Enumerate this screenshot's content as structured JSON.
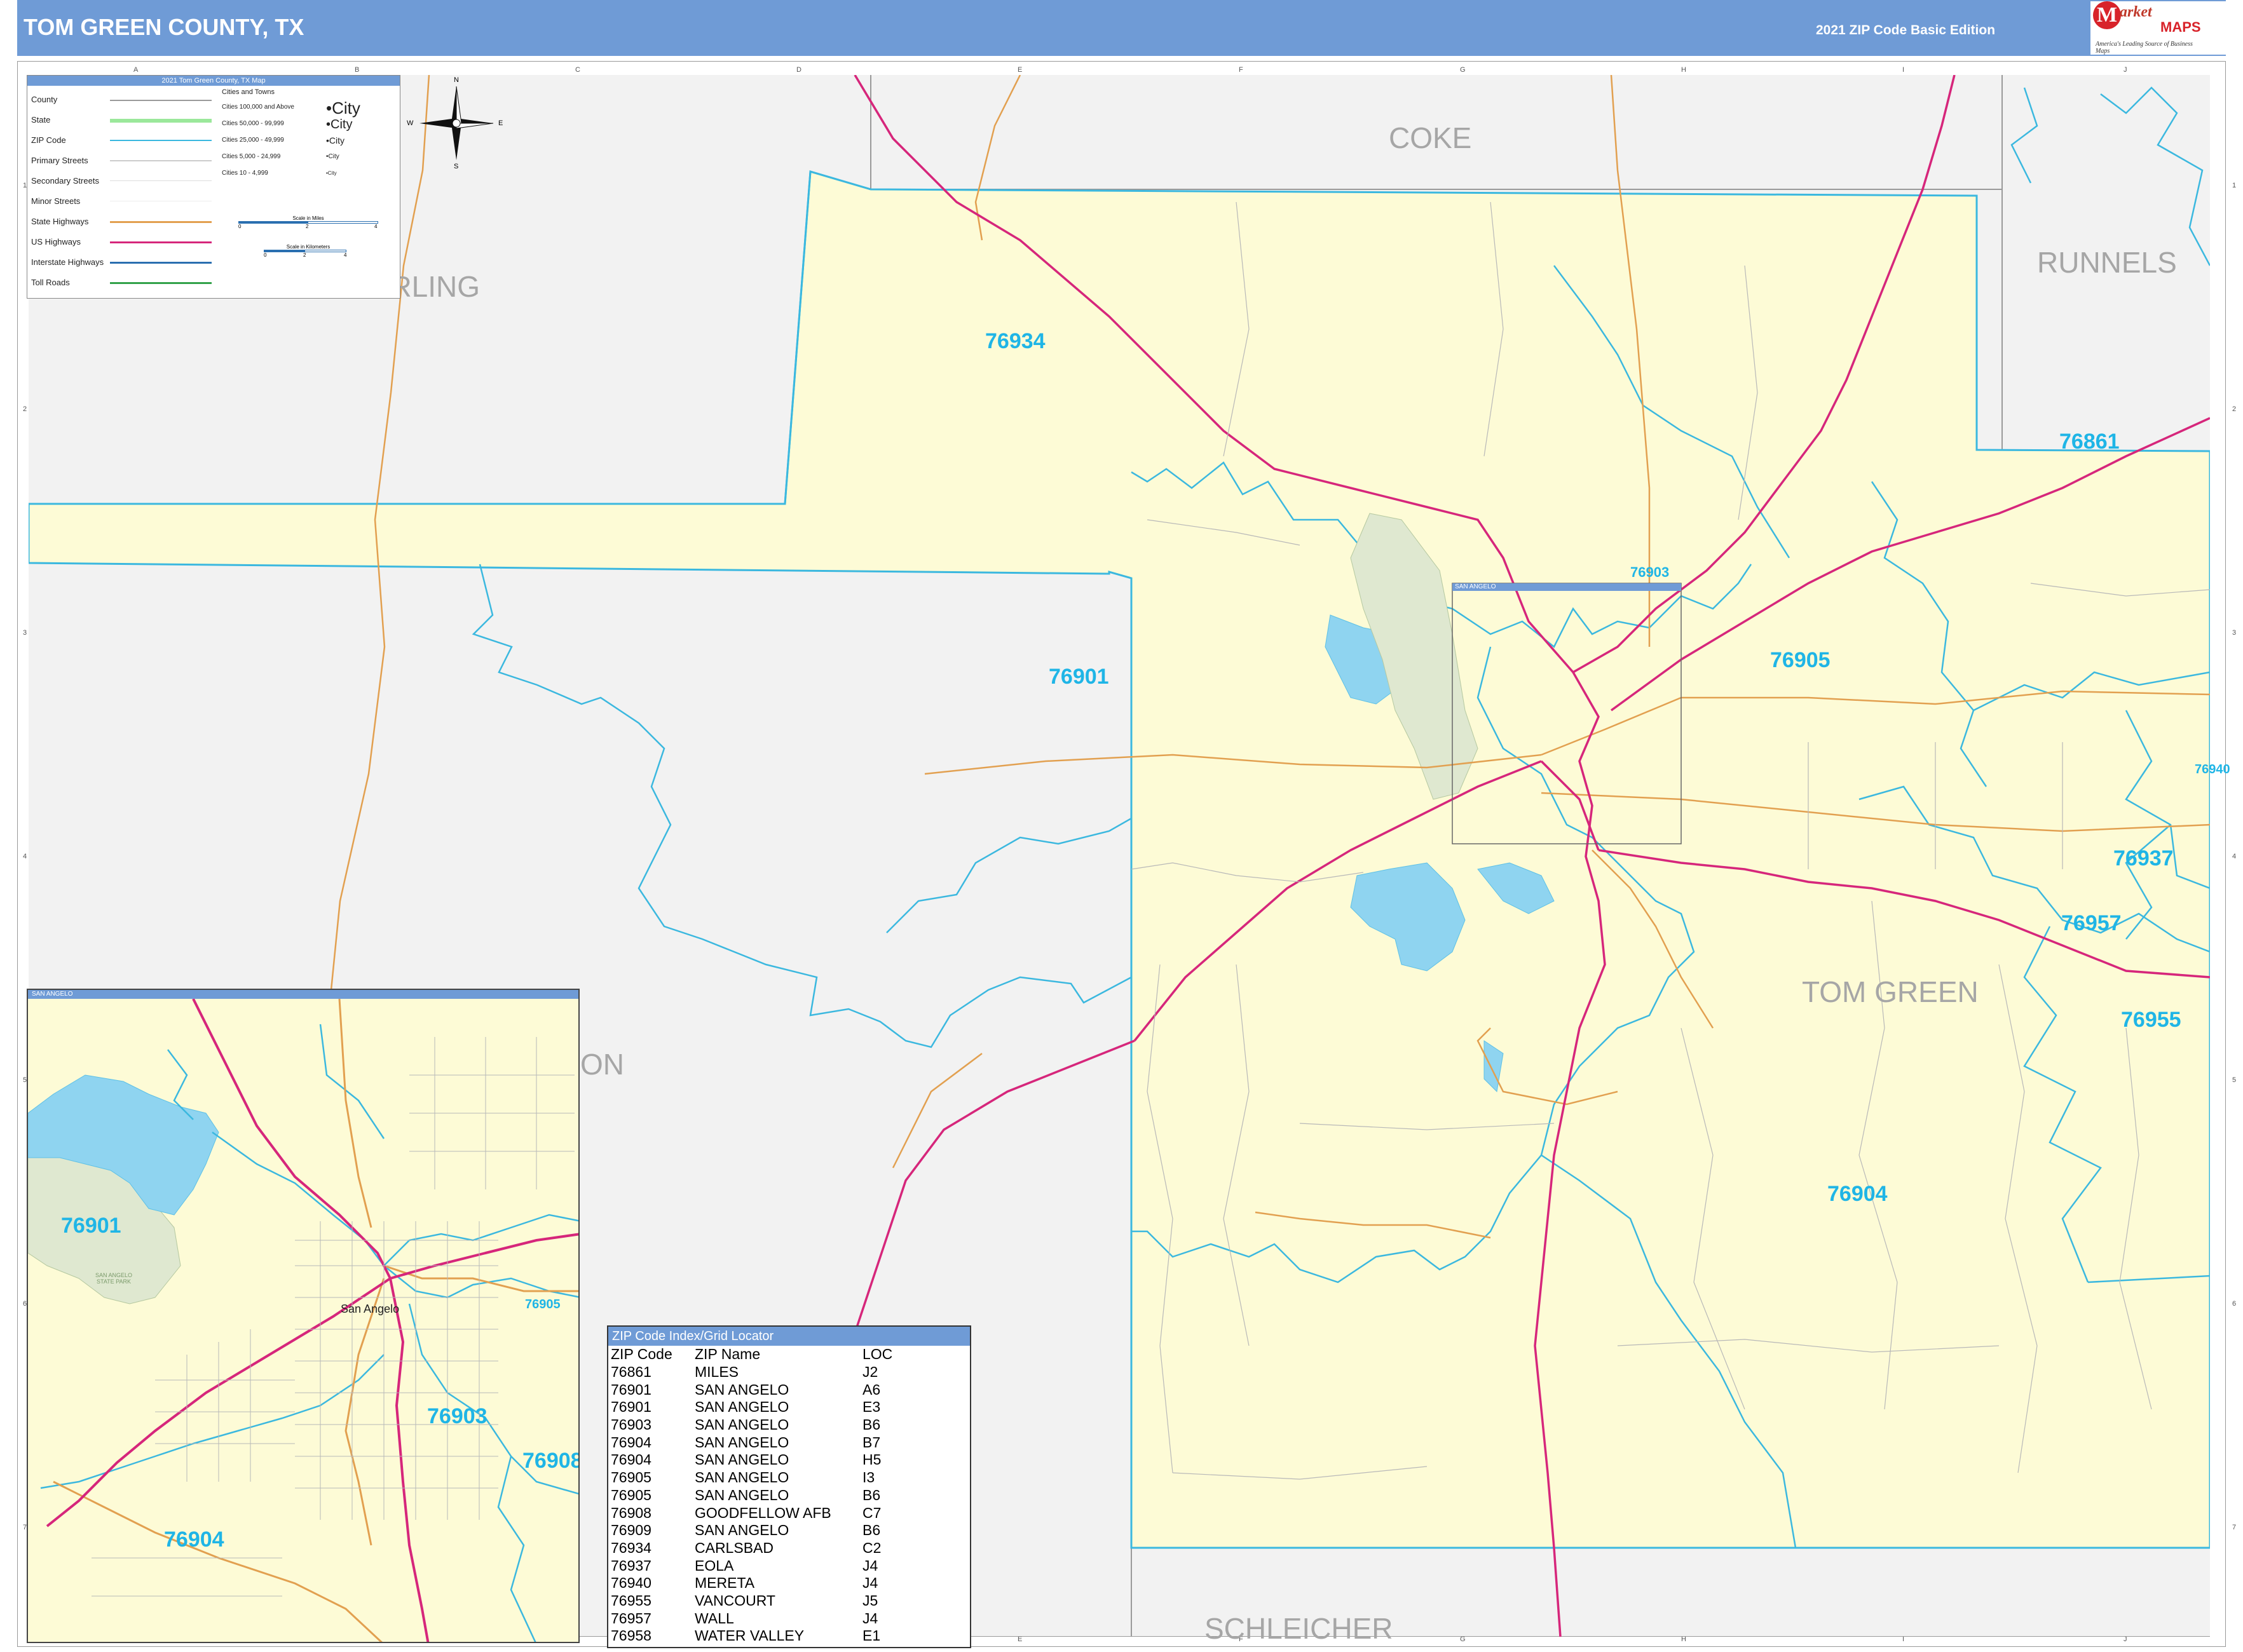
{
  "header": {
    "title": "TOM GREEN COUNTY, TX",
    "edition": "2021 ZIP Code Basic Edition"
  },
  "logo": {
    "mark": "M",
    "market": "arket",
    "maps": "MAPS",
    "tagline": "America's Leading Source of Business Maps"
  },
  "grid": {
    "columns": [
      "A",
      "B",
      "C",
      "D",
      "E",
      "F",
      "G",
      "H",
      "I",
      "J"
    ],
    "rows": [
      "1",
      "2",
      "3",
      "4",
      "5",
      "6",
      "7"
    ]
  },
  "map": {
    "counties": {
      "coke": "COKE",
      "runnels": "RUNNELS",
      "sterling": "STERLING",
      "tom_green": "TOM GREEN",
      "schleicher": "SCHLEICHER",
      "irion_fragment": "ON"
    },
    "zips": {
      "z76934": "76934",
      "z76901": "76901",
      "z76903": "76903",
      "z76905": "76905",
      "z76861": "76861",
      "z76940": "76940",
      "z76937": "76937",
      "z76957": "76957",
      "z76955": "76955",
      "z76904": "76904"
    },
    "san_angelo_box_label": "SAN ANGELO",
    "colors": {
      "county_fill": "#fdfbd6",
      "outside_fill": "#f2f2f2",
      "zip_line": "#3bb8df",
      "us_highway": "#d6267b",
      "state_highway": "#e2a050",
      "lake": "#8fd4f0",
      "park": "#dfe8d0"
    }
  },
  "legend": {
    "title": "2021 Tom Green County, TX Map",
    "items": [
      {
        "label": "County",
        "color": "#9a9a9a"
      },
      {
        "label": "State",
        "color": "#9be89b"
      },
      {
        "label": "ZIP Code",
        "color": "#3bb8df"
      },
      {
        "label": "Primary Streets",
        "color": "#cccccc"
      },
      {
        "label": "Secondary Streets",
        "color": "#dddddd"
      },
      {
        "label": "Minor Streets",
        "color": "#eeeeee"
      },
      {
        "label": "State Highways",
        "color": "#e2a050"
      },
      {
        "label": "US Highways",
        "color": "#d6267b"
      },
      {
        "label": "Interstate Highways",
        "color": "#2a6fb0"
      },
      {
        "label": "Toll Roads",
        "color": "#33a24a"
      }
    ],
    "cities_heading": "Cities and Towns",
    "cities": [
      {
        "label": "Cities 100,000 and Above",
        "sample": "•City"
      },
      {
        "label": "Cities 50,000 - 99,999",
        "sample": "•City"
      },
      {
        "label": "Cities 25,000 - 49,999",
        "sample": "•City"
      },
      {
        "label": "Cities 5,000 - 24,999",
        "sample": "•City"
      },
      {
        "label": "Cities 10 - 4,999",
        "sample": "•City"
      }
    ],
    "compass": {
      "n": "N",
      "s": "S",
      "e": "E",
      "w": "W"
    },
    "scale_miles": "Scale in Miles",
    "scale_km": "Scale in Kilometers",
    "scale_miles_ticks": [
      "0",
      "2",
      "4"
    ],
    "scale_km_ticks": [
      "0",
      "2",
      "4"
    ]
  },
  "inset": {
    "title": "SAN ANGELO",
    "city": "San Angelo",
    "zips": {
      "z76901": "76901",
      "z76903": "76903",
      "z76905": "76905",
      "z76908": "76908",
      "z76904": "76904"
    },
    "park_label": "SAN ANGELO STATE PARK"
  },
  "zip_index": {
    "title": "ZIP Code Index/Grid Locator",
    "headers": [
      "ZIP Code",
      "ZIP Name",
      "LOC"
    ],
    "rows": [
      [
        "76861",
        "MILES",
        "J2"
      ],
      [
        "76901",
        "SAN ANGELO",
        "A6"
      ],
      [
        "76901",
        "SAN ANGELO",
        "E3"
      ],
      [
        "76903",
        "SAN ANGELO",
        "B6"
      ],
      [
        "76904",
        "SAN ANGELO",
        "B7"
      ],
      [
        "76904",
        "SAN ANGELO",
        "H5"
      ],
      [
        "76905",
        "SAN ANGELO",
        "I3"
      ],
      [
        "76905",
        "SAN ANGELO",
        "B6"
      ],
      [
        "76908",
        "GOODFELLOW AFB",
        "C7"
      ],
      [
        "76909",
        "SAN ANGELO",
        "B6"
      ],
      [
        "76934",
        "CARLSBAD",
        "C2"
      ],
      [
        "76937",
        "EOLA",
        "J4"
      ],
      [
        "76940",
        "MERETA",
        "J4"
      ],
      [
        "76955",
        "VANCOURT",
        "J5"
      ],
      [
        "76957",
        "WALL",
        "J4"
      ],
      [
        "76958",
        "WATER VALLEY",
        "E1"
      ]
    ]
  }
}
